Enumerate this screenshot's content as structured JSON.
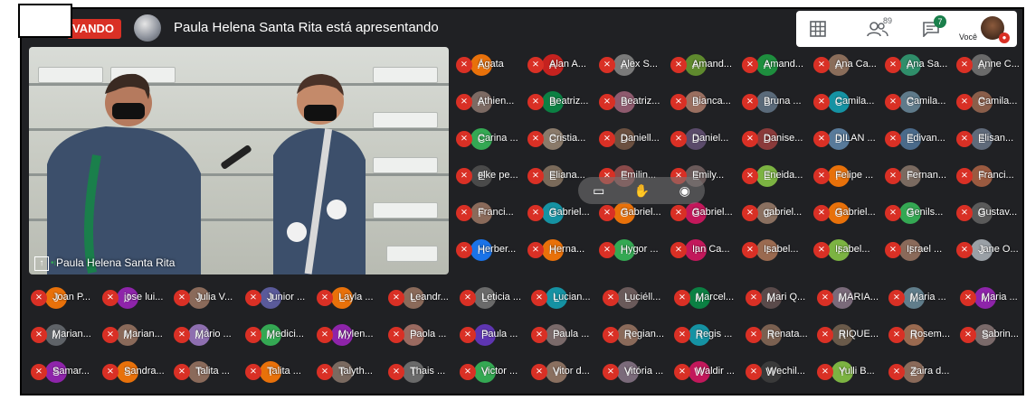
{
  "header": {
    "recording_label": "VANDO",
    "presenting_text": "Paula Helena Santa Rita está apresentando",
    "people_count": "89",
    "chat_badge": "7",
    "self_label": "Você"
  },
  "video": {
    "presenter_name": "Paula Helena Santa Rita"
  },
  "toast_icons": [
    "present-icon",
    "hand-icon",
    "eye-icon"
  ],
  "participants": [
    {
      "name": "Ágata",
      "color": "#e8710a"
    },
    {
      "name": "Alan A...",
      "color": "#c5221f"
    },
    {
      "name": "Alex S...",
      "color": "#7a7a7a"
    },
    {
      "name": "Amand...",
      "color": "#5f8a2e"
    },
    {
      "name": "Amand...",
      "color": "#1e8e3e"
    },
    {
      "name": "Ana Ca...",
      "color": "#8a6d5a"
    },
    {
      "name": "Ana Sa...",
      "color": "#2f8e6a"
    },
    {
      "name": "Anne C...",
      "color": "#6a6a6a"
    },
    {
      "name": "Athien...",
      "color": "#7c6a63"
    },
    {
      "name": "Beatriz...",
      "color": "#0b8043"
    },
    {
      "name": "Beatriz...",
      "color": "#8e5a6e"
    },
    {
      "name": "Bianca...",
      "color": "#9a6f60"
    },
    {
      "name": "Bruna ...",
      "color": "#5a6a7a"
    },
    {
      "name": "Camila...",
      "color": "#1592a3"
    },
    {
      "name": "Camila...",
      "color": "#5f7a8a"
    },
    {
      "name": "Camila...",
      "color": "#8a5e4a"
    },
    {
      "name": "Carina ...",
      "color": "#34a853"
    },
    {
      "name": "Cristia...",
      "color": "#8a7a6a"
    },
    {
      "name": "Daniell...",
      "color": "#6b5040"
    },
    {
      "name": "Daniel...",
      "color": "#5a4a6a"
    },
    {
      "name": "Danise...",
      "color": "#8a3a3a"
    },
    {
      "name": "DILAN ...",
      "color": "#587a9a"
    },
    {
      "name": "Edivan...",
      "color": "#4a6a8a"
    },
    {
      "name": "Elisan...",
      "color": "#5f6a7a"
    },
    {
      "name": "elke pe...",
      "color": "#4a4a4a"
    },
    {
      "name": "Eliana...",
      "color": "#7a6a5a"
    },
    {
      "name": "Emilin...",
      "color": "#8a4a4a"
    },
    {
      "name": "Emily...",
      "color": "#6a5a5a"
    },
    {
      "name": "Eneida...",
      "color": "#7cb342"
    },
    {
      "name": "Felipe ...",
      "color": "#e8710a"
    },
    {
      "name": "Fernan...",
      "color": "#7a6a60"
    },
    {
      "name": "Franci...",
      "color": "#9a5a40"
    },
    {
      "name": "Franci...",
      "color": "#8a6a5a"
    },
    {
      "name": "Gabriel...",
      "color": "#1592a3"
    },
    {
      "name": "Gabriel...",
      "color": "#e8710a"
    },
    {
      "name": "Gabriel...",
      "color": "#c2185b"
    },
    {
      "name": "gabriel...",
      "color": "#8a7060"
    },
    {
      "name": "Gabriel...",
      "color": "#e8710a"
    },
    {
      "name": "Genils...",
      "color": "#34a853"
    },
    {
      "name": "Gustav...",
      "color": "#5a5a5a"
    },
    {
      "name": "Herber...",
      "color": "#1a73e8"
    },
    {
      "name": "Herna...",
      "color": "#e8710a"
    },
    {
      "name": "Hygor ...",
      "color": "#34a853"
    },
    {
      "name": "Ian Ca...",
      "color": "#c2185b"
    },
    {
      "name": "Isabel...",
      "color": "#9a6a50"
    },
    {
      "name": "Isabel...",
      "color": "#7cb342"
    },
    {
      "name": "Israel ...",
      "color": "#8a6a5a"
    },
    {
      "name": "Jane O...",
      "color": "#9aa0a6"
    },
    {
      "name": "Joan P...",
      "color": "#e8710a"
    },
    {
      "name": "jose lui...",
      "color": "#8e24aa"
    },
    {
      "name": "Julia V...",
      "color": "#8a6a5a"
    },
    {
      "name": "Junior ...",
      "color": "#5a5a9a"
    },
    {
      "name": "Layla ...",
      "color": "#e8710a"
    },
    {
      "name": "Leandr...",
      "color": "#8a6a5a"
    },
    {
      "name": "Leticia ...",
      "color": "#6a6a6a"
    },
    {
      "name": "Lucian...",
      "color": "#1592a3"
    },
    {
      "name": "Luciéll...",
      "color": "#6a5a5a"
    },
    {
      "name": "Marcel...",
      "color": "#0b8043"
    },
    {
      "name": "Mari Q...",
      "color": "#5a4a4a"
    },
    {
      "name": "MARIA...",
      "color": "#7a6a7a"
    },
    {
      "name": "Maria ...",
      "color": "#607d8b"
    },
    {
      "name": "Maria ...",
      "color": "#8e24aa"
    },
    {
      "name": "Marian...",
      "color": "#5f6368"
    },
    {
      "name": "Marian...",
      "color": "#8a6a5a"
    },
    {
      "name": "Mário ...",
      "color": "#8e6fb0"
    },
    {
      "name": "Medici...",
      "color": "#34a853"
    },
    {
      "name": "Mylen...",
      "color": "#8e24aa"
    },
    {
      "name": "Paola ...",
      "color": "#9a6a60"
    },
    {
      "name": "Paula ...",
      "color": "#5e35b1"
    },
    {
      "name": "Paula ...",
      "color": "#7a6a6a"
    },
    {
      "name": "Regian...",
      "color": "#8a6a5a"
    },
    {
      "name": "Regis ...",
      "color": "#1592a3"
    },
    {
      "name": "Renata...",
      "color": "#7a6050"
    },
    {
      "name": "RIQUE...",
      "color": "#6a5a4a"
    },
    {
      "name": "Rosem...",
      "color": "#9a6a50"
    },
    {
      "name": "Sabrin...",
      "color": "#7a6a6a"
    },
    {
      "name": "Samar...",
      "color": "#8e24aa"
    },
    {
      "name": "Sandra...",
      "color": "#e8710a"
    },
    {
      "name": "Talita ...",
      "color": "#8a6a5a"
    },
    {
      "name": "Talita ...",
      "color": "#e8710a"
    },
    {
      "name": "Talyth...",
      "color": "#7a6a60"
    },
    {
      "name": "Thais ...",
      "color": "#6a6a6a"
    },
    {
      "name": "Victor ...",
      "color": "#34a853"
    },
    {
      "name": "Vitor d...",
      "color": "#8a7060"
    },
    {
      "name": "Vitória ...",
      "color": "#7a6a7a"
    },
    {
      "name": "Waldir ...",
      "color": "#c2185b"
    },
    {
      "name": "Wechil...",
      "color": "#3a3a3a"
    },
    {
      "name": "Yulli B...",
      "color": "#7cb342"
    },
    {
      "name": "Zaira d...",
      "color": "#8a6a5a"
    }
  ]
}
